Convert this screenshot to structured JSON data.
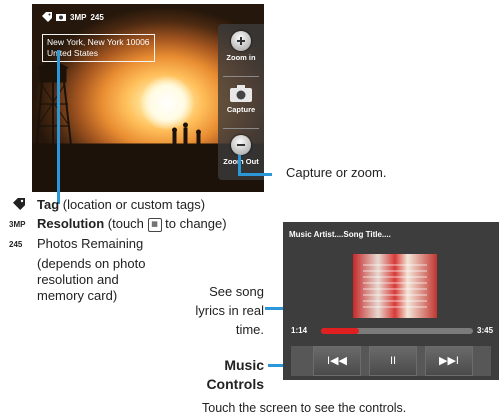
{
  "camera": {
    "resolution_label": "3MP",
    "photos_remaining": "245",
    "location_line1": "New York, New York 10006",
    "location_line2": "United States",
    "buttons": {
      "zoom_in": "Zoom in",
      "capture": "Capture",
      "zoom_out": "Zoom Out"
    }
  },
  "callouts": {
    "capture_or_zoom": "Capture or zoom.",
    "tag_title": "Tag",
    "tag_desc": " (location or custom tags)",
    "resolution_icon": "3MP",
    "resolution_title": "Resolution",
    "resolution_desc_pre": " (touch ",
    "resolution_desc_post": " to change)",
    "photos_icon": "245",
    "photos_title": "Photos Remaining",
    "photos_desc_1": "(depends on photo",
    "photos_desc_2": "resolution and",
    "photos_desc_3": "memory card)",
    "lyrics_1": "See song",
    "lyrics_2": "lyrics in real",
    "lyrics_3": "time.",
    "music_controls_1": "Music",
    "music_controls_2": "Controls",
    "footer": "Touch the screen to see the controls."
  },
  "player": {
    "title": "Music Artist....Song Title....",
    "elapsed": "1:14",
    "total": "3:45",
    "progress": 0.25,
    "prev_label": "I◀◀",
    "pause_label": "II",
    "next_label": "▶▶I"
  },
  "colors": {
    "accent": "#2b97d9",
    "progress": "#e02020"
  }
}
